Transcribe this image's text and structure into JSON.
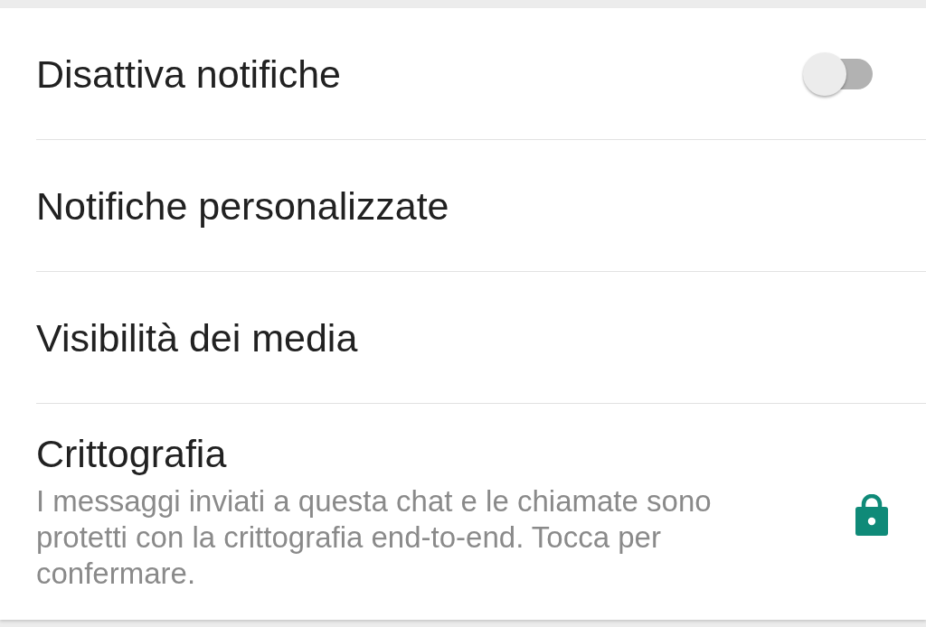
{
  "settings": [
    {
      "kind": "toggle",
      "title": "Disattiva notifiche",
      "on": false
    },
    {
      "kind": "plain",
      "title": "Notifiche personalizzate"
    },
    {
      "kind": "plain",
      "title": "Visibilità dei media"
    },
    {
      "kind": "info",
      "title": "Crittografia",
      "description": "I messaggi inviati a questa chat e le chiamate sono protetti con la crittografia end-to-end. Tocca per confermare."
    }
  ]
}
